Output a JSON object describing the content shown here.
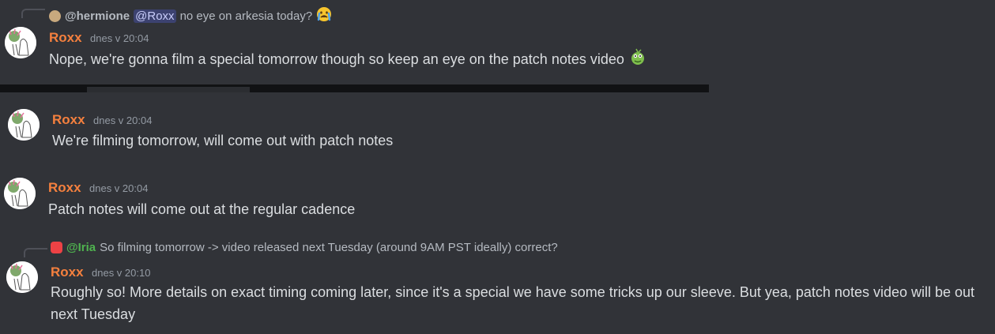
{
  "messages": [
    {
      "reply": {
        "user": "@hermione",
        "mention": "@Roxx",
        "text": "no eye on arkesia today?"
      },
      "author": "Roxx",
      "timestamp": "dnes v 20:04",
      "content": "Nope, we're gonna film a special tomorrow though so keep an eye on the patch notes video"
    },
    {
      "author": "Roxx",
      "timestamp": "dnes v 20:04",
      "content": "We're filming tomorrow, will come out with patch notes"
    },
    {
      "author": "Roxx",
      "timestamp": "dnes v 20:04",
      "content": "Patch notes will come out at the regular cadence"
    },
    {
      "reply": {
        "user": "@Iria",
        "text": "So filming tomorrow -> video released next Tuesday (around 9AM PST ideally) correct?"
      },
      "author": "Roxx",
      "timestamp": "dnes v 20:10",
      "content": "Roughly so! More details on exact timing coming later, since it's a special we have some tricks up our sleeve. But yea, patch notes video will be out next Tuesday"
    }
  ],
  "colors": {
    "background": "#313338",
    "username": "#f5803e",
    "timestamp": "#949ba4",
    "text": "#dbdee1",
    "mention_bg": "#3c4270",
    "iria_name": "#4fb34f"
  },
  "icons": {
    "reply_emoji_1": "crying-face-emoji",
    "inline_emoji": "pepe-frog-emoji",
    "iria_avatar": "discord-red-icon"
  }
}
